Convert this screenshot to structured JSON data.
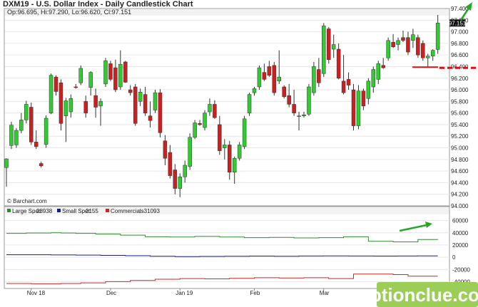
{
  "header": {
    "title": "DXM19 - U.S. Dollar Index - Daily Candlestick Chart",
    "ohlc": "Op:96.695, Hi:97.290, Lo:96.620, Cl:97.151",
    "last_price_label": "97.151",
    "credit": "© Barchart.com"
  },
  "watermark": {
    "text": "optionclue.com"
  },
  "colors": {
    "up": "#2ecc2e",
    "down": "#cc1f1f",
    "large_spec": "#2e8b2e",
    "small_spec": "#1a1a8c",
    "commercials": "#d42424",
    "annotation": "#2aa52a",
    "dashed_line": "#dd1111",
    "panel_bg": "#f2f2f2"
  },
  "x_axis": {
    "labels": [
      "Nov 18",
      "Dec",
      "Jan 19",
      "Feb",
      "Mar"
    ]
  },
  "chart_data": [
    {
      "type": "candlestick",
      "title": "DXM19 - U.S. Dollar Index - Daily Candlestick Chart",
      "ylim": [
        94.0,
        97.4
      ],
      "y_ticks": [
        "94.000",
        "94.200",
        "94.400",
        "94.600",
        "94.800",
        "95.000",
        "95.200",
        "95.400",
        "95.600",
        "95.800",
        "96.000",
        "96.200",
        "96.400",
        "96.600",
        "96.800",
        "97.000",
        "97.200",
        "97.400"
      ],
      "last_price": 97.151,
      "reference_level": 96.39,
      "candles": [
        {
          "o": 94.66,
          "h": 94.82,
          "l": 94.33,
          "c": 94.81
        },
        {
          "o": 95.04,
          "h": 95.45,
          "l": 94.98,
          "c": 95.39
        },
        {
          "o": 95.05,
          "h": 95.34,
          "l": 95.0,
          "c": 95.3
        },
        {
          "o": 95.3,
          "h": 95.6,
          "l": 95.25,
          "c": 95.48
        },
        {
          "o": 95.48,
          "h": 95.81,
          "l": 95.42,
          "c": 95.75
        },
        {
          "o": 95.7,
          "h": 95.78,
          "l": 95.05,
          "c": 95.1
        },
        {
          "o": 95.1,
          "h": 95.3,
          "l": 94.98,
          "c": 95.02
        },
        {
          "o": 94.73,
          "h": 94.76,
          "l": 94.66,
          "c": 94.69
        },
        {
          "o": 95.06,
          "h": 95.56,
          "l": 95.0,
          "c": 95.51
        },
        {
          "o": 95.6,
          "h": 96.28,
          "l": 95.58,
          "c": 96.25
        },
        {
          "o": 96.22,
          "h": 96.25,
          "l": 95.9,
          "c": 95.97
        },
        {
          "o": 96.12,
          "h": 96.18,
          "l": 95.3,
          "c": 95.42
        },
        {
          "o": 95.55,
          "h": 95.86,
          "l": 95.1,
          "c": 95.81
        },
        {
          "o": 95.62,
          "h": 95.92,
          "l": 95.52,
          "c": 95.85
        },
        {
          "o": 96.05,
          "h": 96.1,
          "l": 96.02,
          "c": 96.04
        },
        {
          "o": 96.12,
          "h": 96.42,
          "l": 96.08,
          "c": 96.37
        },
        {
          "o": 95.8,
          "h": 95.9,
          "l": 95.52,
          "c": 95.6
        },
        {
          "o": 96.04,
          "h": 96.32,
          "l": 95.9,
          "c": 96.3
        },
        {
          "o": 95.9,
          "h": 96.02,
          "l": 95.52,
          "c": 95.7
        },
        {
          "o": 95.72,
          "h": 95.85,
          "l": 95.38,
          "c": 95.8
        },
        {
          "o": 96.1,
          "h": 96.55,
          "l": 96.05,
          "c": 96.5
        },
        {
          "o": 96.45,
          "h": 96.5,
          "l": 96.15,
          "c": 96.18
        },
        {
          "o": 96.38,
          "h": 96.52,
          "l": 95.96,
          "c": 96.0
        },
        {
          "o": 96.05,
          "h": 96.68,
          "l": 96.0,
          "c": 96.44
        },
        {
          "o": 96.48,
          "h": 96.5,
          "l": 96.12,
          "c": 96.13
        },
        {
          "o": 96.0,
          "h": 96.08,
          "l": 95.9,
          "c": 95.95
        },
        {
          "o": 96.05,
          "h": 96.1,
          "l": 95.38,
          "c": 95.42
        },
        {
          "o": 95.8,
          "h": 96.02,
          "l": 95.72,
          "c": 95.96
        },
        {
          "o": 95.92,
          "h": 96.05,
          "l": 95.55,
          "c": 95.6
        },
        {
          "o": 95.55,
          "h": 95.8,
          "l": 95.35,
          "c": 95.47
        },
        {
          "o": 95.65,
          "h": 96.0,
          "l": 95.6,
          "c": 95.95
        },
        {
          "o": 95.95,
          "h": 96.01,
          "l": 95.18,
          "c": 95.26
        },
        {
          "o": 95.12,
          "h": 95.22,
          "l": 94.7,
          "c": 94.82
        },
        {
          "o": 94.92,
          "h": 95.05,
          "l": 94.47,
          "c": 94.52
        },
        {
          "o": 94.62,
          "h": 94.72,
          "l": 94.2,
          "c": 94.3
        },
        {
          "o": 94.3,
          "h": 94.56,
          "l": 94.15,
          "c": 94.5
        },
        {
          "o": 94.5,
          "h": 94.78,
          "l": 94.4,
          "c": 94.7
        },
        {
          "o": 94.68,
          "h": 95.25,
          "l": 94.62,
          "c": 95.18
        },
        {
          "o": 95.18,
          "h": 95.48,
          "l": 95.15,
          "c": 95.43
        },
        {
          "o": 95.42,
          "h": 95.48,
          "l": 95.38,
          "c": 95.4
        },
        {
          "o": 95.35,
          "h": 95.65,
          "l": 95.3,
          "c": 95.6
        },
        {
          "o": 95.62,
          "h": 95.85,
          "l": 95.55,
          "c": 95.75
        },
        {
          "o": 95.75,
          "h": 95.82,
          "l": 95.5,
          "c": 95.52
        },
        {
          "o": 95.4,
          "h": 95.55,
          "l": 94.88,
          "c": 94.95
        },
        {
          "o": 95.0,
          "h": 95.15,
          "l": 94.8,
          "c": 95.05
        },
        {
          "o": 95.05,
          "h": 95.12,
          "l": 94.45,
          "c": 94.58
        },
        {
          "o": 94.58,
          "h": 94.85,
          "l": 94.38,
          "c": 94.82
        },
        {
          "o": 94.82,
          "h": 95.1,
          "l": 94.78,
          "c": 95.05
        },
        {
          "o": 95.02,
          "h": 95.55,
          "l": 94.98,
          "c": 95.5
        },
        {
          "o": 95.6,
          "h": 95.95,
          "l": 95.55,
          "c": 95.92
        },
        {
          "o": 95.95,
          "h": 96.05,
          "l": 95.9,
          "c": 96.02
        },
        {
          "o": 96.05,
          "h": 96.42,
          "l": 96.0,
          "c": 96.38
        },
        {
          "o": 96.3,
          "h": 96.45,
          "l": 96.15,
          "c": 96.18
        },
        {
          "o": 96.4,
          "h": 96.5,
          "l": 96.22,
          "c": 96.25
        },
        {
          "o": 96.42,
          "h": 96.48,
          "l": 95.9,
          "c": 95.95
        },
        {
          "o": 96.15,
          "h": 96.68,
          "l": 96.1,
          "c": 96.22
        },
        {
          "o": 96.05,
          "h": 96.08,
          "l": 95.85,
          "c": 95.88
        },
        {
          "o": 95.9,
          "h": 96.1,
          "l": 95.7,
          "c": 95.75
        },
        {
          "o": 95.75,
          "h": 96.0,
          "l": 95.55,
          "c": 95.6
        },
        {
          "o": 95.55,
          "h": 95.62,
          "l": 95.3,
          "c": 95.55
        },
        {
          "o": 95.55,
          "h": 95.62,
          "l": 95.52,
          "c": 95.57
        },
        {
          "o": 95.58,
          "h": 96.1,
          "l": 95.55,
          "c": 96.05
        },
        {
          "o": 95.95,
          "h": 96.48,
          "l": 95.9,
          "c": 96.4
        },
        {
          "o": 96.35,
          "h": 96.55,
          "l": 96.05,
          "c": 96.12
        },
        {
          "o": 96.28,
          "h": 97.15,
          "l": 96.22,
          "c": 97.1
        },
        {
          "o": 97.05,
          "h": 97.08,
          "l": 96.45,
          "c": 96.52
        },
        {
          "o": 96.7,
          "h": 96.95,
          "l": 96.55,
          "c": 96.78
        },
        {
          "o": 96.7,
          "h": 96.8,
          "l": 96.18,
          "c": 96.2
        },
        {
          "o": 96.15,
          "h": 96.6,
          "l": 95.92,
          "c": 95.95
        },
        {
          "o": 96.18,
          "h": 96.3,
          "l": 96.0,
          "c": 96.08
        },
        {
          "o": 96.0,
          "h": 96.1,
          "l": 95.3,
          "c": 95.38
        },
        {
          "o": 95.38,
          "h": 96.08,
          "l": 95.32,
          "c": 95.98
        },
        {
          "o": 95.98,
          "h": 96.02,
          "l": 95.65,
          "c": 95.72
        },
        {
          "o": 95.85,
          "h": 96.2,
          "l": 95.75,
          "c": 96.15
        },
        {
          "o": 96.05,
          "h": 96.4,
          "l": 95.95,
          "c": 96.35
        },
        {
          "o": 96.18,
          "h": 96.5,
          "l": 96.1,
          "c": 96.45
        },
        {
          "o": 96.42,
          "h": 96.55,
          "l": 96.36,
          "c": 96.38
        },
        {
          "o": 96.55,
          "h": 96.9,
          "l": 96.5,
          "c": 96.85
        },
        {
          "o": 96.82,
          "h": 96.96,
          "l": 96.72,
          "c": 96.74
        },
        {
          "o": 96.78,
          "h": 96.9,
          "l": 96.68,
          "c": 96.85
        },
        {
          "o": 96.9,
          "h": 97.02,
          "l": 96.82,
          "c": 96.85
        },
        {
          "o": 96.9,
          "h": 97.0,
          "l": 96.6,
          "c": 96.65
        },
        {
          "o": 96.85,
          "h": 97.05,
          "l": 96.72,
          "c": 96.95
        },
        {
          "o": 96.9,
          "h": 96.95,
          "l": 96.55,
          "c": 96.6
        },
        {
          "o": 96.8,
          "h": 96.85,
          "l": 96.5,
          "c": 96.55
        },
        {
          "o": 96.55,
          "h": 96.62,
          "l": 96.4,
          "c": 96.58
        },
        {
          "o": 96.58,
          "h": 96.7,
          "l": 96.5,
          "c": 96.68
        },
        {
          "o": 96.695,
          "h": 97.29,
          "l": 96.62,
          "c": 97.151
        }
      ]
    },
    {
      "type": "line",
      "title": "",
      "ylim": [
        -50000,
        70000
      ],
      "y_ticks": [
        "60000",
        "40000",
        "20000",
        "0",
        "-20000",
        "-40000"
      ],
      "legend_position": "top-left",
      "series": [
        {
          "name": "Large Spec",
          "legend_value": "28938",
          "values": [
            39000,
            39000,
            39000,
            39000,
            39500,
            39500,
            39500,
            39500,
            39500,
            40000,
            40000,
            39500,
            39500,
            39500,
            39000,
            39000,
            39000,
            39000,
            38000,
            38000,
            38000,
            38000,
            38000,
            36000,
            36000,
            36000,
            36000,
            36000,
            33500,
            33500,
            33500,
            33500,
            33500,
            33000,
            33000,
            33000,
            33000,
            33000,
            34000,
            34000,
            34000,
            34000,
            34000,
            33000,
            33000,
            33000,
            33000,
            33000,
            32000,
            32000,
            32000,
            32000,
            32000,
            32500,
            32500,
            32500,
            32500,
            32500,
            31500,
            31500,
            31500,
            31500,
            31500,
            32000,
            32000,
            32000,
            32000,
            32000,
            33500,
            33500,
            33500,
            33500,
            33500,
            26000,
            26000,
            26000,
            26000,
            26000,
            25000,
            25000,
            25000,
            25000,
            25000,
            29000,
            29000,
            29000,
            29000,
            28938
          ]
        },
        {
          "name": "Small Spec",
          "legend_value": "2155",
          "values": [
            4000,
            4000,
            4000,
            4000,
            4000,
            4000,
            4000,
            4000,
            4000,
            3800,
            3800,
            3800,
            3800,
            3800,
            3500,
            3500,
            3500,
            3500,
            3500,
            3000,
            3000,
            3000,
            3000,
            3000,
            2500,
            2500,
            2500,
            2500,
            2500,
            1500,
            1500,
            1500,
            1500,
            1500,
            1000,
            1000,
            1000,
            1000,
            1000,
            1200,
            1200,
            1200,
            1200,
            1200,
            1500,
            1500,
            1500,
            1500,
            1500,
            1800,
            1800,
            1800,
            1800,
            1800,
            1600,
            1600,
            1600,
            1600,
            1600,
            2000,
            2000,
            2000,
            2000,
            2000,
            2200,
            2200,
            2200,
            2200,
            2200,
            2000,
            2000,
            2000,
            2000,
            2000,
            1800,
            1800,
            1800,
            1800,
            1800,
            2000,
            2000,
            2000,
            2000,
            2155,
            2155,
            2155,
            2155,
            2155
          ]
        },
        {
          "name": "Commercials",
          "legend_value": "-31093",
          "values": [
            -43000,
            -43000,
            -43000,
            -43000,
            -43000,
            -43500,
            -43500,
            -43500,
            -43500,
            -43500,
            -43500,
            -43000,
            -43000,
            -43000,
            -43000,
            -42000,
            -42000,
            -42000,
            -42000,
            -42000,
            -40000,
            -40000,
            -40000,
            -40000,
            -40000,
            -38000,
            -38000,
            -38000,
            -38000,
            -38000,
            -36000,
            -36000,
            -36000,
            -36000,
            -36000,
            -35000,
            -35000,
            -35000,
            -35000,
            -35000,
            -35500,
            -35500,
            -35500,
            -35500,
            -35500,
            -34500,
            -34500,
            -34500,
            -34500,
            -34500,
            -33500,
            -33500,
            -33500,
            -33500,
            -33500,
            -34000,
            -34000,
            -34000,
            -34000,
            -34000,
            -33500,
            -33500,
            -33500,
            -33500,
            -33500,
            -35000,
            -35000,
            -35000,
            -35000,
            -35000,
            -27500,
            -27500,
            -27500,
            -27500,
            -27500,
            -27500,
            -27500,
            -27500,
            -28500,
            -28500,
            -28500,
            -31000,
            -31000,
            -31000,
            -31000,
            -31093,
            -31093,
            -31093
          ]
        }
      ]
    }
  ]
}
